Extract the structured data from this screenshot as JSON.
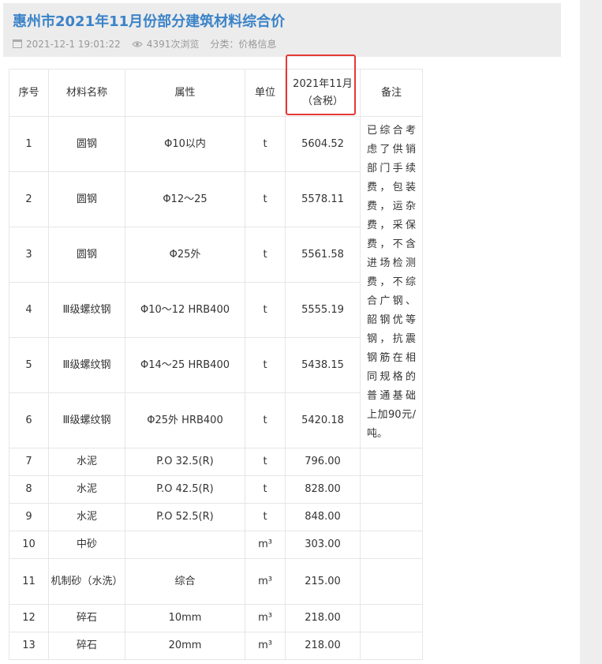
{
  "article": {
    "title": "惠州市2021年11月份部分建筑材料综合价",
    "date": "2021-12-1 19:01:22",
    "views": "4391次浏览",
    "category": "分类：价格信息",
    "icons": {
      "date": "calendar-icon",
      "views": "eye-icon"
    }
  },
  "table": {
    "headers": {
      "no": "序号",
      "name": "材料名称",
      "attr": "属性",
      "unit": "单位",
      "price_line1": "2021年11月",
      "price_line2": "（含税）",
      "note": "备注"
    },
    "note_text": "已综合考虑了供销部门手续费，包装费，运杂费，采保费，不含进场检测费，不综合广钢、韶钢优等钢，抗震钢筋在相同规格的普通基础上加90元/吨。",
    "rows": [
      {
        "no": "1",
        "name": "圆钢",
        "attr": "Φ10以内",
        "unit": "t",
        "price": "5604.52"
      },
      {
        "no": "2",
        "name": "圆钢",
        "attr": "Φ12～25",
        "unit": "t",
        "price": "5578.11"
      },
      {
        "no": "3",
        "name": "圆钢",
        "attr": "Φ25外",
        "unit": "t",
        "price": "5561.58"
      },
      {
        "no": "4",
        "name": "Ⅲ级螺纹钢",
        "attr": "Φ10～12 HRB400",
        "unit": "t",
        "price": "5555.19"
      },
      {
        "no": "5",
        "name": "Ⅲ级螺纹钢",
        "attr": "Φ14～25 HRB400",
        "unit": "t",
        "price": "5438.15"
      },
      {
        "no": "6",
        "name": "Ⅲ级螺纹钢",
        "attr": "Φ25外 HRB400",
        "unit": "t",
        "price": "5420.18"
      },
      {
        "no": "7",
        "name": "水泥",
        "attr": "P.O 32.5(R)",
        "unit": "t",
        "price": "796.00"
      },
      {
        "no": "8",
        "name": "水泥",
        "attr": "P.O 42.5(R)",
        "unit": "t",
        "price": "828.00"
      },
      {
        "no": "9",
        "name": "水泥",
        "attr": "P.O 52.5(R)",
        "unit": "t",
        "price": "848.00"
      },
      {
        "no": "10",
        "name": "中砂",
        "attr": "",
        "unit": "m³",
        "price": "303.00"
      },
      {
        "no": "11",
        "name": "机制砂（水洗）",
        "attr": "综合",
        "unit": "m³",
        "price": "215.00"
      },
      {
        "no": "12",
        "name": "碎石",
        "attr": "10mm",
        "unit": "m³",
        "price": "218.00"
      },
      {
        "no": "13",
        "name": "碎石",
        "attr": "20mm",
        "unit": "m³",
        "price": "218.00"
      }
    ]
  },
  "colors": {
    "title": "#3b83c8",
    "highlight_box": "#e53935",
    "header_bg": "#ececec"
  }
}
